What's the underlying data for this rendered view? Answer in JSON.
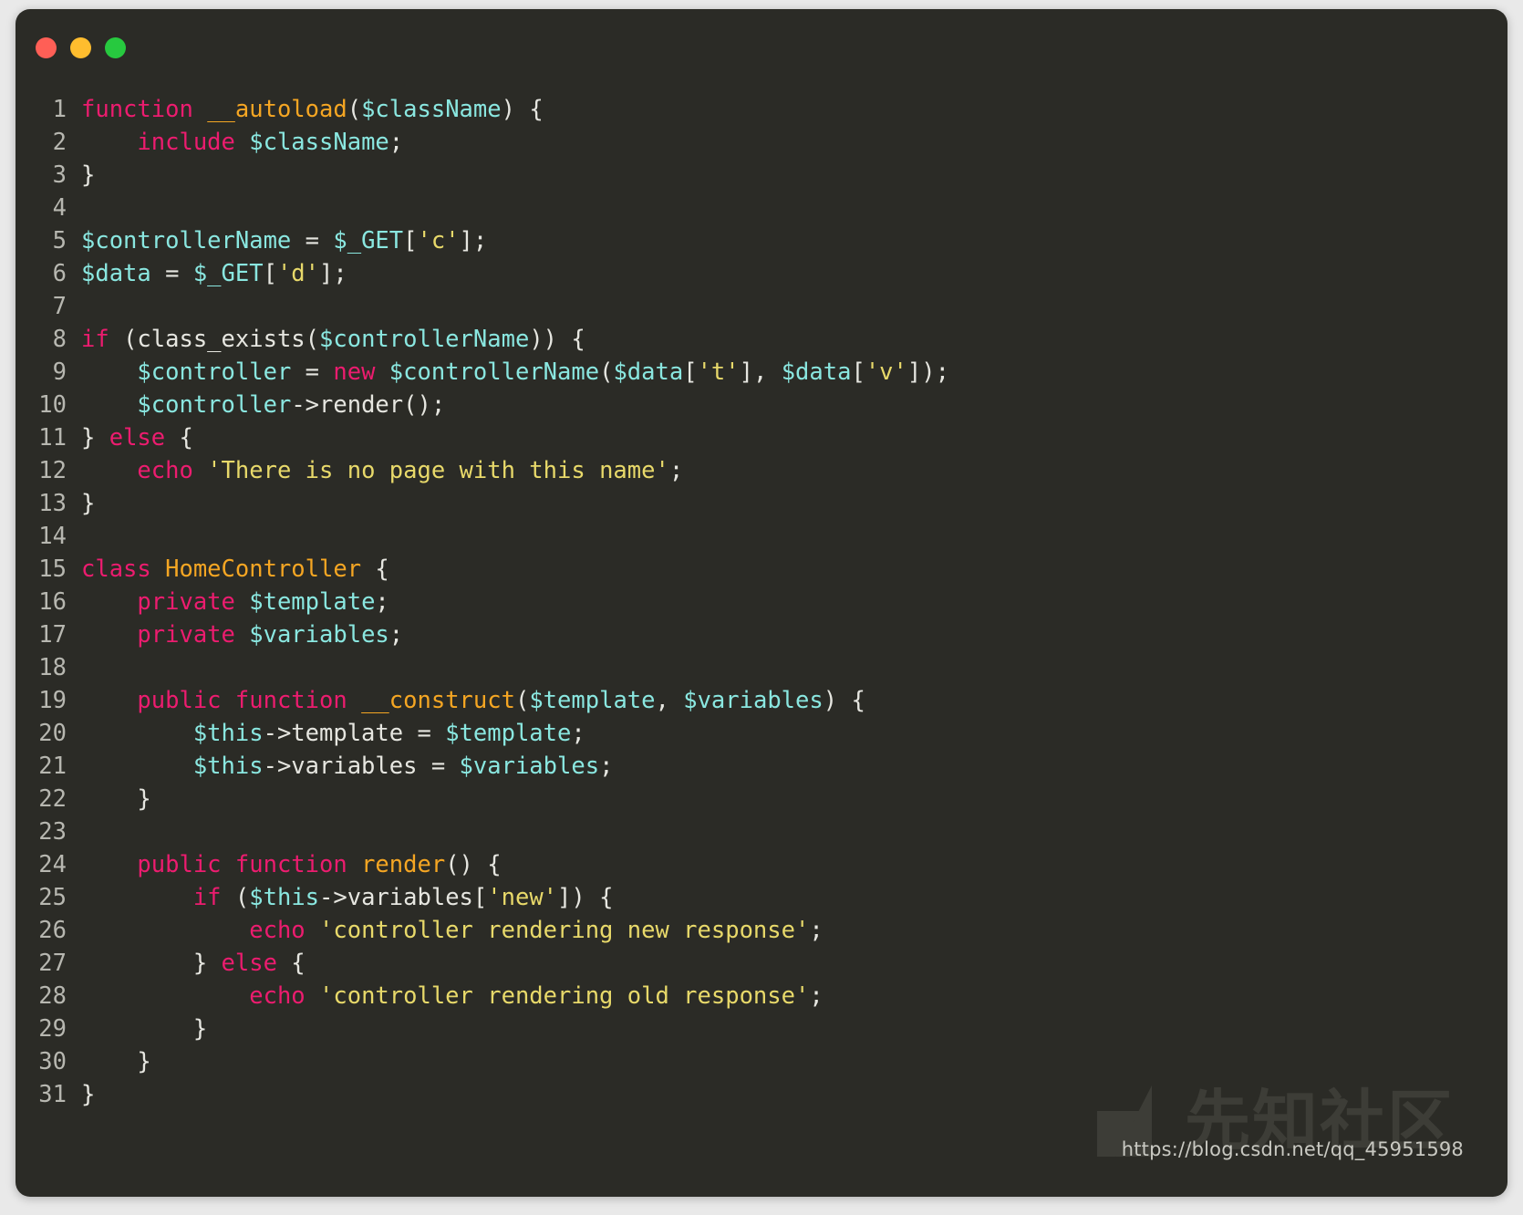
{
  "window": {
    "title": "",
    "background_color": "#2b2b26",
    "page_background_color": "#e9e9e9",
    "traffic_lights": [
      {
        "name": "close",
        "color": "#ff5f56"
      },
      {
        "name": "minimize",
        "color": "#ffbd2e"
      },
      {
        "name": "maximize",
        "color": "#27c93f"
      }
    ]
  },
  "theme": {
    "keyword": "#ec1c6f",
    "function_name": "#f5a623",
    "variable": "#8ae7e0",
    "string": "#e8d96a",
    "plain": "#e6e6e0",
    "line_number": "#b7b7b0"
  },
  "code": {
    "language": "php",
    "lines": [
      {
        "n": "1",
        "tokens": [
          {
            "t": "function",
            "c": "kw"
          },
          {
            "t": " ",
            "c": "pl"
          },
          {
            "t": "__autoload",
            "c": "fn"
          },
          {
            "t": "(",
            "c": "pl"
          },
          {
            "t": "$className",
            "c": "var"
          },
          {
            "t": ") {",
            "c": "pl"
          }
        ]
      },
      {
        "n": "2",
        "tokens": [
          {
            "t": "    ",
            "c": "pl"
          },
          {
            "t": "include",
            "c": "kw"
          },
          {
            "t": " ",
            "c": "pl"
          },
          {
            "t": "$className",
            "c": "var"
          },
          {
            "t": ";",
            "c": "pl"
          }
        ]
      },
      {
        "n": "3",
        "tokens": [
          {
            "t": "}",
            "c": "pl"
          }
        ]
      },
      {
        "n": "4",
        "tokens": []
      },
      {
        "n": "5",
        "tokens": [
          {
            "t": "$controllerName",
            "c": "var"
          },
          {
            "t": " = ",
            "c": "pl"
          },
          {
            "t": "$_GET",
            "c": "var"
          },
          {
            "t": "[",
            "c": "pl"
          },
          {
            "t": "'c'",
            "c": "str"
          },
          {
            "t": "];",
            "c": "pl"
          }
        ]
      },
      {
        "n": "6",
        "tokens": [
          {
            "t": "$data",
            "c": "var"
          },
          {
            "t": " = ",
            "c": "pl"
          },
          {
            "t": "$_GET",
            "c": "var"
          },
          {
            "t": "[",
            "c": "pl"
          },
          {
            "t": "'d'",
            "c": "str"
          },
          {
            "t": "];",
            "c": "pl"
          }
        ]
      },
      {
        "n": "7",
        "tokens": []
      },
      {
        "n": "8",
        "tokens": [
          {
            "t": "if",
            "c": "kw"
          },
          {
            "t": " (class_exists(",
            "c": "pl"
          },
          {
            "t": "$controllerName",
            "c": "var"
          },
          {
            "t": ")) {",
            "c": "pl"
          }
        ]
      },
      {
        "n": "9",
        "tokens": [
          {
            "t": "    ",
            "c": "pl"
          },
          {
            "t": "$controller",
            "c": "var"
          },
          {
            "t": " = ",
            "c": "pl"
          },
          {
            "t": "new",
            "c": "kw"
          },
          {
            "t": " ",
            "c": "pl"
          },
          {
            "t": "$controllerName",
            "c": "var"
          },
          {
            "t": "(",
            "c": "pl"
          },
          {
            "t": "$data",
            "c": "var"
          },
          {
            "t": "[",
            "c": "pl"
          },
          {
            "t": "'t'",
            "c": "str"
          },
          {
            "t": "], ",
            "c": "pl"
          },
          {
            "t": "$data",
            "c": "var"
          },
          {
            "t": "[",
            "c": "pl"
          },
          {
            "t": "'v'",
            "c": "str"
          },
          {
            "t": "]);",
            "c": "pl"
          }
        ]
      },
      {
        "n": "10",
        "tokens": [
          {
            "t": "    ",
            "c": "pl"
          },
          {
            "t": "$controller",
            "c": "var"
          },
          {
            "t": "->render();",
            "c": "pl"
          }
        ]
      },
      {
        "n": "11",
        "tokens": [
          {
            "t": "} ",
            "c": "pl"
          },
          {
            "t": "else",
            "c": "kw"
          },
          {
            "t": " {",
            "c": "pl"
          }
        ]
      },
      {
        "n": "12",
        "tokens": [
          {
            "t": "    ",
            "c": "pl"
          },
          {
            "t": "echo",
            "c": "kw"
          },
          {
            "t": " ",
            "c": "pl"
          },
          {
            "t": "'There is no page with this name'",
            "c": "str"
          },
          {
            "t": ";",
            "c": "pl"
          }
        ]
      },
      {
        "n": "13",
        "tokens": [
          {
            "t": "}",
            "c": "pl"
          }
        ]
      },
      {
        "n": "14",
        "tokens": []
      },
      {
        "n": "15",
        "tokens": [
          {
            "t": "class",
            "c": "kw"
          },
          {
            "t": " ",
            "c": "pl"
          },
          {
            "t": "HomeController",
            "c": "fn"
          },
          {
            "t": " {",
            "c": "pl"
          }
        ]
      },
      {
        "n": "16",
        "tokens": [
          {
            "t": "    ",
            "c": "pl"
          },
          {
            "t": "private",
            "c": "kw"
          },
          {
            "t": " ",
            "c": "pl"
          },
          {
            "t": "$template",
            "c": "var"
          },
          {
            "t": ";",
            "c": "pl"
          }
        ]
      },
      {
        "n": "17",
        "tokens": [
          {
            "t": "    ",
            "c": "pl"
          },
          {
            "t": "private",
            "c": "kw"
          },
          {
            "t": " ",
            "c": "pl"
          },
          {
            "t": "$variables",
            "c": "var"
          },
          {
            "t": ";",
            "c": "pl"
          }
        ]
      },
      {
        "n": "18",
        "tokens": []
      },
      {
        "n": "19",
        "tokens": [
          {
            "t": "    ",
            "c": "pl"
          },
          {
            "t": "public function",
            "c": "kw"
          },
          {
            "t": " ",
            "c": "pl"
          },
          {
            "t": "__construct",
            "c": "fn"
          },
          {
            "t": "(",
            "c": "pl"
          },
          {
            "t": "$template",
            "c": "var"
          },
          {
            "t": ", ",
            "c": "pl"
          },
          {
            "t": "$variables",
            "c": "var"
          },
          {
            "t": ") {",
            "c": "pl"
          }
        ]
      },
      {
        "n": "20",
        "tokens": [
          {
            "t": "        ",
            "c": "pl"
          },
          {
            "t": "$this",
            "c": "var"
          },
          {
            "t": "->template = ",
            "c": "pl"
          },
          {
            "t": "$template",
            "c": "var"
          },
          {
            "t": ";",
            "c": "pl"
          }
        ]
      },
      {
        "n": "21",
        "tokens": [
          {
            "t": "        ",
            "c": "pl"
          },
          {
            "t": "$this",
            "c": "var"
          },
          {
            "t": "->variables = ",
            "c": "pl"
          },
          {
            "t": "$variables",
            "c": "var"
          },
          {
            "t": ";",
            "c": "pl"
          }
        ]
      },
      {
        "n": "22",
        "tokens": [
          {
            "t": "    }",
            "c": "pl"
          }
        ]
      },
      {
        "n": "23",
        "tokens": []
      },
      {
        "n": "24",
        "tokens": [
          {
            "t": "    ",
            "c": "pl"
          },
          {
            "t": "public function",
            "c": "kw"
          },
          {
            "t": " ",
            "c": "pl"
          },
          {
            "t": "render",
            "c": "fn"
          },
          {
            "t": "() {",
            "c": "pl"
          }
        ]
      },
      {
        "n": "25",
        "tokens": [
          {
            "t": "        ",
            "c": "pl"
          },
          {
            "t": "if",
            "c": "kw"
          },
          {
            "t": " (",
            "c": "pl"
          },
          {
            "t": "$this",
            "c": "var"
          },
          {
            "t": "->variables[",
            "c": "pl"
          },
          {
            "t": "'new'",
            "c": "str"
          },
          {
            "t": "]) {",
            "c": "pl"
          }
        ]
      },
      {
        "n": "26",
        "tokens": [
          {
            "t": "            ",
            "c": "pl"
          },
          {
            "t": "echo",
            "c": "kw"
          },
          {
            "t": " ",
            "c": "pl"
          },
          {
            "t": "'controller rendering new response'",
            "c": "str"
          },
          {
            "t": ";",
            "c": "pl"
          }
        ]
      },
      {
        "n": "27",
        "tokens": [
          {
            "t": "        } ",
            "c": "pl"
          },
          {
            "t": "else",
            "c": "kw"
          },
          {
            "t": " {",
            "c": "pl"
          }
        ]
      },
      {
        "n": "28",
        "tokens": [
          {
            "t": "            ",
            "c": "pl"
          },
          {
            "t": "echo",
            "c": "kw"
          },
          {
            "t": " ",
            "c": "pl"
          },
          {
            "t": "'controller rendering old response'",
            "c": "str"
          },
          {
            "t": ";",
            "c": "pl"
          }
        ]
      },
      {
        "n": "29",
        "tokens": [
          {
            "t": "        }",
            "c": "pl"
          }
        ]
      },
      {
        "n": "30",
        "tokens": [
          {
            "t": "    }",
            "c": "pl"
          }
        ]
      },
      {
        "n": "31",
        "tokens": [
          {
            "t": "}",
            "c": "pl"
          }
        ]
      }
    ]
  },
  "watermark": {
    "text": "先知社区",
    "color": "#3d3d37"
  },
  "footer": {
    "blog_url": "https://blog.csdn.net/qq_45951598"
  }
}
